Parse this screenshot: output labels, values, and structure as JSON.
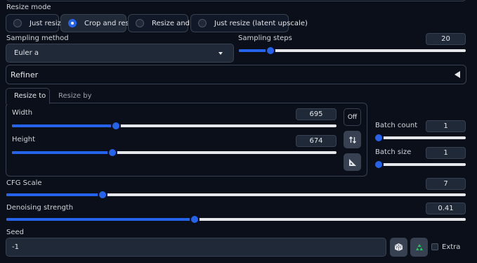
{
  "resize_mode": {
    "label": "Resize mode",
    "options": [
      "Just resize",
      "Crop and resize",
      "Resize and fill",
      "Just resize (latent upscale)"
    ],
    "selected": "Crop and resize"
  },
  "sampling_method": {
    "label": "Sampling method",
    "value": "Euler a"
  },
  "sampling_steps": {
    "label": "Sampling steps",
    "value": "20",
    "fraction": 0.14
  },
  "refiner": {
    "label": "Refiner"
  },
  "size_tabs": {
    "tabs": [
      "Resize to",
      "Resize by"
    ],
    "active": "Resize to"
  },
  "width": {
    "label": "Width",
    "value": "695",
    "fraction": 0.32
  },
  "height": {
    "label": "Height",
    "value": "674",
    "fraction": 0.31
  },
  "aspect_toggle": {
    "label": "Off"
  },
  "batch_count": {
    "label": "Batch count",
    "value": "1",
    "fraction": 0.0
  },
  "batch_size": {
    "label": "Batch size",
    "value": "1",
    "fraction": 0.0
  },
  "cfg_scale": {
    "label": "CFG Scale",
    "value": "7",
    "fraction": 0.21
  },
  "denoising_strength": {
    "label": "Denoising strength",
    "value": "0.41",
    "fraction": 0.41
  },
  "seed": {
    "label": "Seed",
    "value": "-1",
    "extra_label": "Extra"
  },
  "colors": {
    "accent": "#2563eb",
    "background": "#0b0f19",
    "panel": "#1f2937",
    "recycle": "#22c55e"
  }
}
